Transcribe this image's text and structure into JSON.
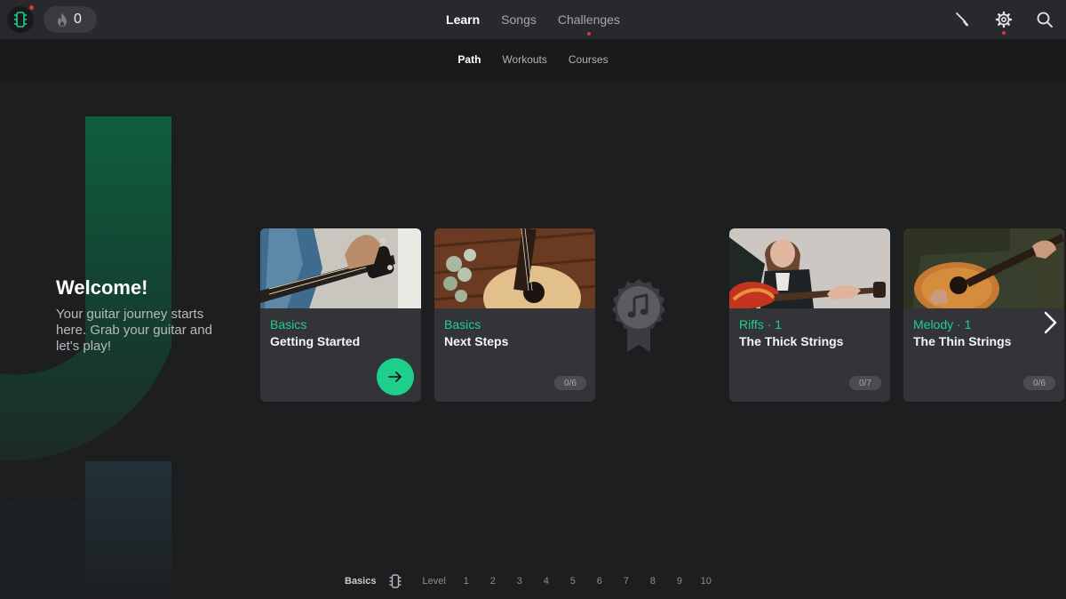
{
  "header": {
    "streak_count": "0",
    "nav": [
      {
        "label": "Learn",
        "active": true
      },
      {
        "label": "Songs",
        "active": false
      },
      {
        "label": "Challenges",
        "active": false
      }
    ]
  },
  "subnav": [
    {
      "label": "Path",
      "active": true
    },
    {
      "label": "Workouts",
      "active": false
    },
    {
      "label": "Courses",
      "active": false
    }
  ],
  "welcome": {
    "title": "Welcome!",
    "text": "Your guitar journey starts here. Grab your guitar and let's play!"
  },
  "cards": [
    {
      "category": "Basics",
      "title": "Getting Started",
      "progress": ""
    },
    {
      "category": "Basics",
      "title": "Next Steps",
      "progress": "0/6"
    },
    {
      "category": "Riffs · 1",
      "title": "The Thick Strings",
      "progress": "0/7"
    },
    {
      "category": "Melody · 1",
      "title": "The Thin Strings",
      "progress": "0/6"
    }
  ],
  "levelbar": {
    "current": "Basics",
    "label": "Level",
    "levels": [
      "1",
      "2",
      "3",
      "4",
      "5",
      "6",
      "7",
      "8",
      "9",
      "10"
    ]
  },
  "icons": {
    "logo": "guitar-headstock-icon",
    "streak": "flame-icon",
    "tuner": "tuner-icon",
    "settings": "gear-icon",
    "search": "search-icon",
    "start": "arrow-right-icon",
    "badge": "music-note-badge-icon",
    "next": "chevron-right-icon"
  },
  "colors": {
    "accent": "#1ecf8c",
    "notification": "#e0353d",
    "background": "#1d1e20",
    "card": "#333437"
  }
}
